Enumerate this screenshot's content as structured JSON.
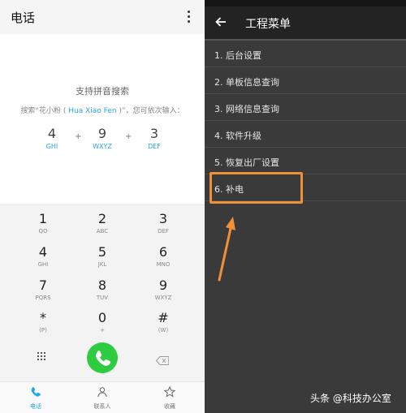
{
  "dialer": {
    "title": "电话",
    "hint_title": "支持拼音搜索",
    "hint_prefix": "搜索“花小粉 (",
    "hint_pinyin": " Hua Xiao Fen ",
    "hint_suffix": ")”，您可依次输入：",
    "hint_digits": [
      {
        "num": "4",
        "letters": "GHI"
      },
      {
        "num": "9",
        "letters": "WXYZ"
      },
      {
        "num": "3",
        "letters": "DEF"
      }
    ],
    "hint_plus": "+",
    "keys": [
      {
        "num": "1",
        "letters": "QO"
      },
      {
        "num": "2",
        "letters": "ABC"
      },
      {
        "num": "3",
        "letters": "DEF"
      },
      {
        "num": "4",
        "letters": "GHI"
      },
      {
        "num": "5",
        "letters": "JKL"
      },
      {
        "num": "6",
        "letters": "MNO"
      },
      {
        "num": "7",
        "letters": "PQRS"
      },
      {
        "num": "8",
        "letters": "TUV"
      },
      {
        "num": "9",
        "letters": "WXYZ"
      },
      {
        "num": "*",
        "letters": "(P)"
      },
      {
        "num": "0",
        "letters": "+"
      },
      {
        "num": "#",
        "letters": "(W)"
      }
    ],
    "nav": [
      {
        "label": "电话",
        "icon": "phone-icon"
      },
      {
        "label": "联系人",
        "icon": "contacts-icon"
      },
      {
        "label": "收藏",
        "icon": "star-icon"
      }
    ],
    "accent": "#22a7f0",
    "call_color": "#2ecc40"
  },
  "engineering": {
    "title": "工程菜单",
    "items": [
      "1. 后台设置",
      "2. 单板信息查询",
      "3. 网络信息查询",
      "4. 软件升级",
      "5. 恢复出厂设置",
      "6. 补电"
    ],
    "highlight_color": "#f0913a"
  },
  "watermark": "头条 @科技办公室"
}
